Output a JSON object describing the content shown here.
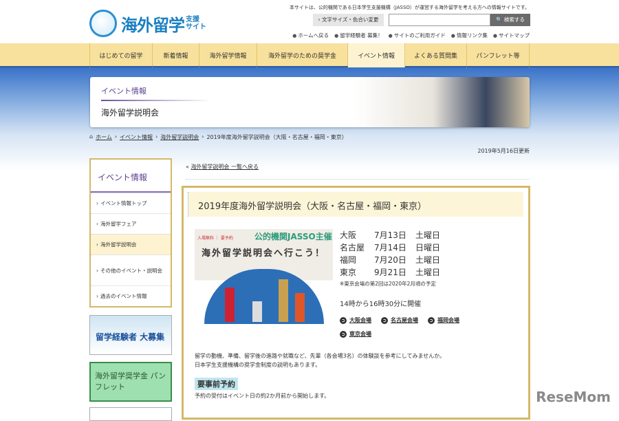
{
  "header": {
    "logo_text": "海外留学",
    "logo_sub": [
      "支援",
      "サイト"
    ],
    "notice": "本サイトは、公的機関である日本学生支援機構（JASSO）が運営する海外留学を考える方への情報サイトです。",
    "font_button": "› 文字サイズ・色合い変更",
    "search_placeholder": "",
    "search_button": "🔍 検索する",
    "util_links": [
      "ホームへ戻る",
      "留学経験者 募集！",
      "サイトのご利用ガイド",
      "情報リンク集",
      "サイトマップ"
    ]
  },
  "nav": [
    "はじめての留学",
    "新着情報",
    "海外留学情報",
    "海外留学のための奨学金",
    "イベント情報",
    "よくある質問集",
    "パンフレット等"
  ],
  "banner": {
    "category": "イベント情報",
    "title": "海外留学説明会"
  },
  "breadcrumb": [
    "ホーム",
    "イベント情報",
    "海外留学説明会",
    "2019年度海外留学説明会（大阪・名古屋・福岡・東京）"
  ],
  "updated": "2019年5月16日更新",
  "sidebar": {
    "heading": "イベント情報",
    "items": [
      "イベント情報トップ",
      "海外留学フェア",
      "海外留学説明会",
      "その他のイベント・説明会",
      "過去のイベント情報"
    ]
  },
  "side_banners": {
    "b1": "留学経験者 大募集",
    "b2": "海外留学奨学金 パンフレット"
  },
  "back_link": "海外留学説明会 一覧へ戻る",
  "event": {
    "title": "2019年度海外留学説明会（大阪・名古屋・福岡・東京）",
    "image": {
      "tags": "入場無料 ｜ 要予約",
      "jasso": "公的機関JASSO主催",
      "headline": "海外留学説明会へ行こう！"
    },
    "schedule": [
      {
        "city": "大阪",
        "date": "7月13日",
        "day": "土曜日"
      },
      {
        "city": "名古屋",
        "date": "7月14日",
        "day": "日曜日"
      },
      {
        "city": "福岡",
        "date": "7月20日",
        "day": "土曜日"
      },
      {
        "city": "東京",
        "date": "9月21日",
        "day": "土曜日"
      }
    ],
    "note": "※東京会場の第2回は2020年2月頃の予定",
    "time": "14時から16時30分に開催",
    "venues": [
      "大阪会場",
      "名古屋会場",
      "福岡会場",
      "東京会場"
    ],
    "desc": [
      "留学の動機、準備、留学後の進路や就職など、先輩（各会場3名）の体験談を参考にしてみませんか。",
      "日本学生支援機構の奨学金制度の説明もあります。"
    ],
    "reservation_heading": "要事前予約",
    "reservation_text": "予約の受付はイベント日の約2か月前から開始します。"
  },
  "watermark": "ReseMom"
}
